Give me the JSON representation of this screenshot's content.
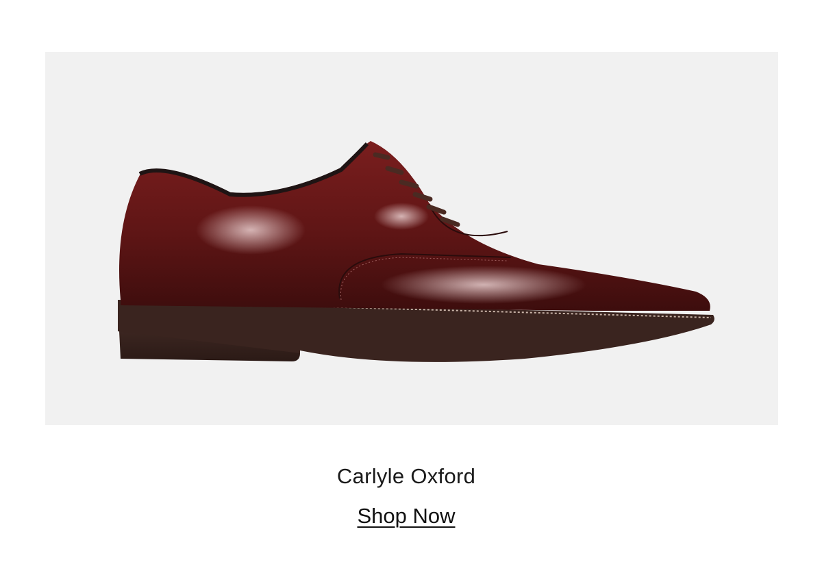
{
  "product": {
    "name": "Carlyle Oxford",
    "cta_label": "Shop Now",
    "image_icon": "oxford-shoe-icon"
  },
  "colors": {
    "background": "#ffffff",
    "image_background": "#f1f1f1",
    "leather": "#6b1a1a",
    "sole": "#3b2620",
    "text": "#111111"
  }
}
